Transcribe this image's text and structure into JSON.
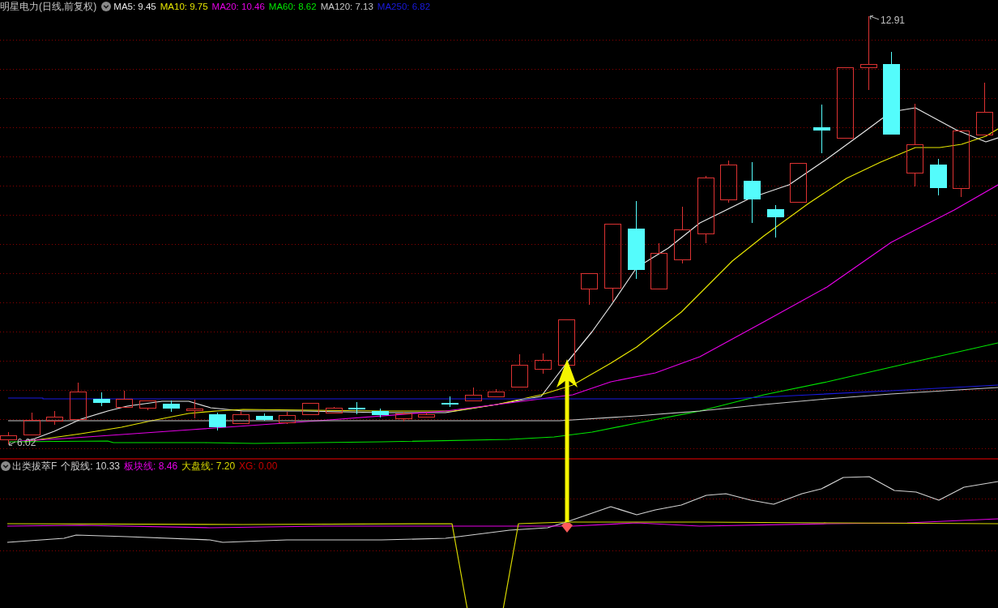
{
  "header": {
    "title": "明星电力(日线,前复权)",
    "indicators": [
      {
        "label": "MA5: 9.45",
        "color": "#e6e6e6"
      },
      {
        "label": "MA10: 9.75",
        "color": "#e6e600"
      },
      {
        "label": "MA20: 10.46",
        "color": "#e600e6"
      },
      {
        "label": "MA60: 8.62",
        "color": "#00e600"
      },
      {
        "label": "MA120: 7.13",
        "color": "#c8c8c8"
      },
      {
        "label": "MA250: 6.82",
        "color": "#1a1ae0"
      }
    ]
  },
  "price_labels": {
    "high": "12.91",
    "low": "6.02"
  },
  "lower_panel": {
    "title": "出类拔萃F",
    "indicators": [
      {
        "label": "个股线: 10.33",
        "color": "#d2d2d2"
      },
      {
        "label": "板块线: 8.46",
        "color": "#e600e6"
      },
      {
        "label": "大盘线: 7.20",
        "color": "#d8d800"
      },
      {
        "label": "XG: 0.00",
        "color": "#c80000"
      }
    ]
  }
}
